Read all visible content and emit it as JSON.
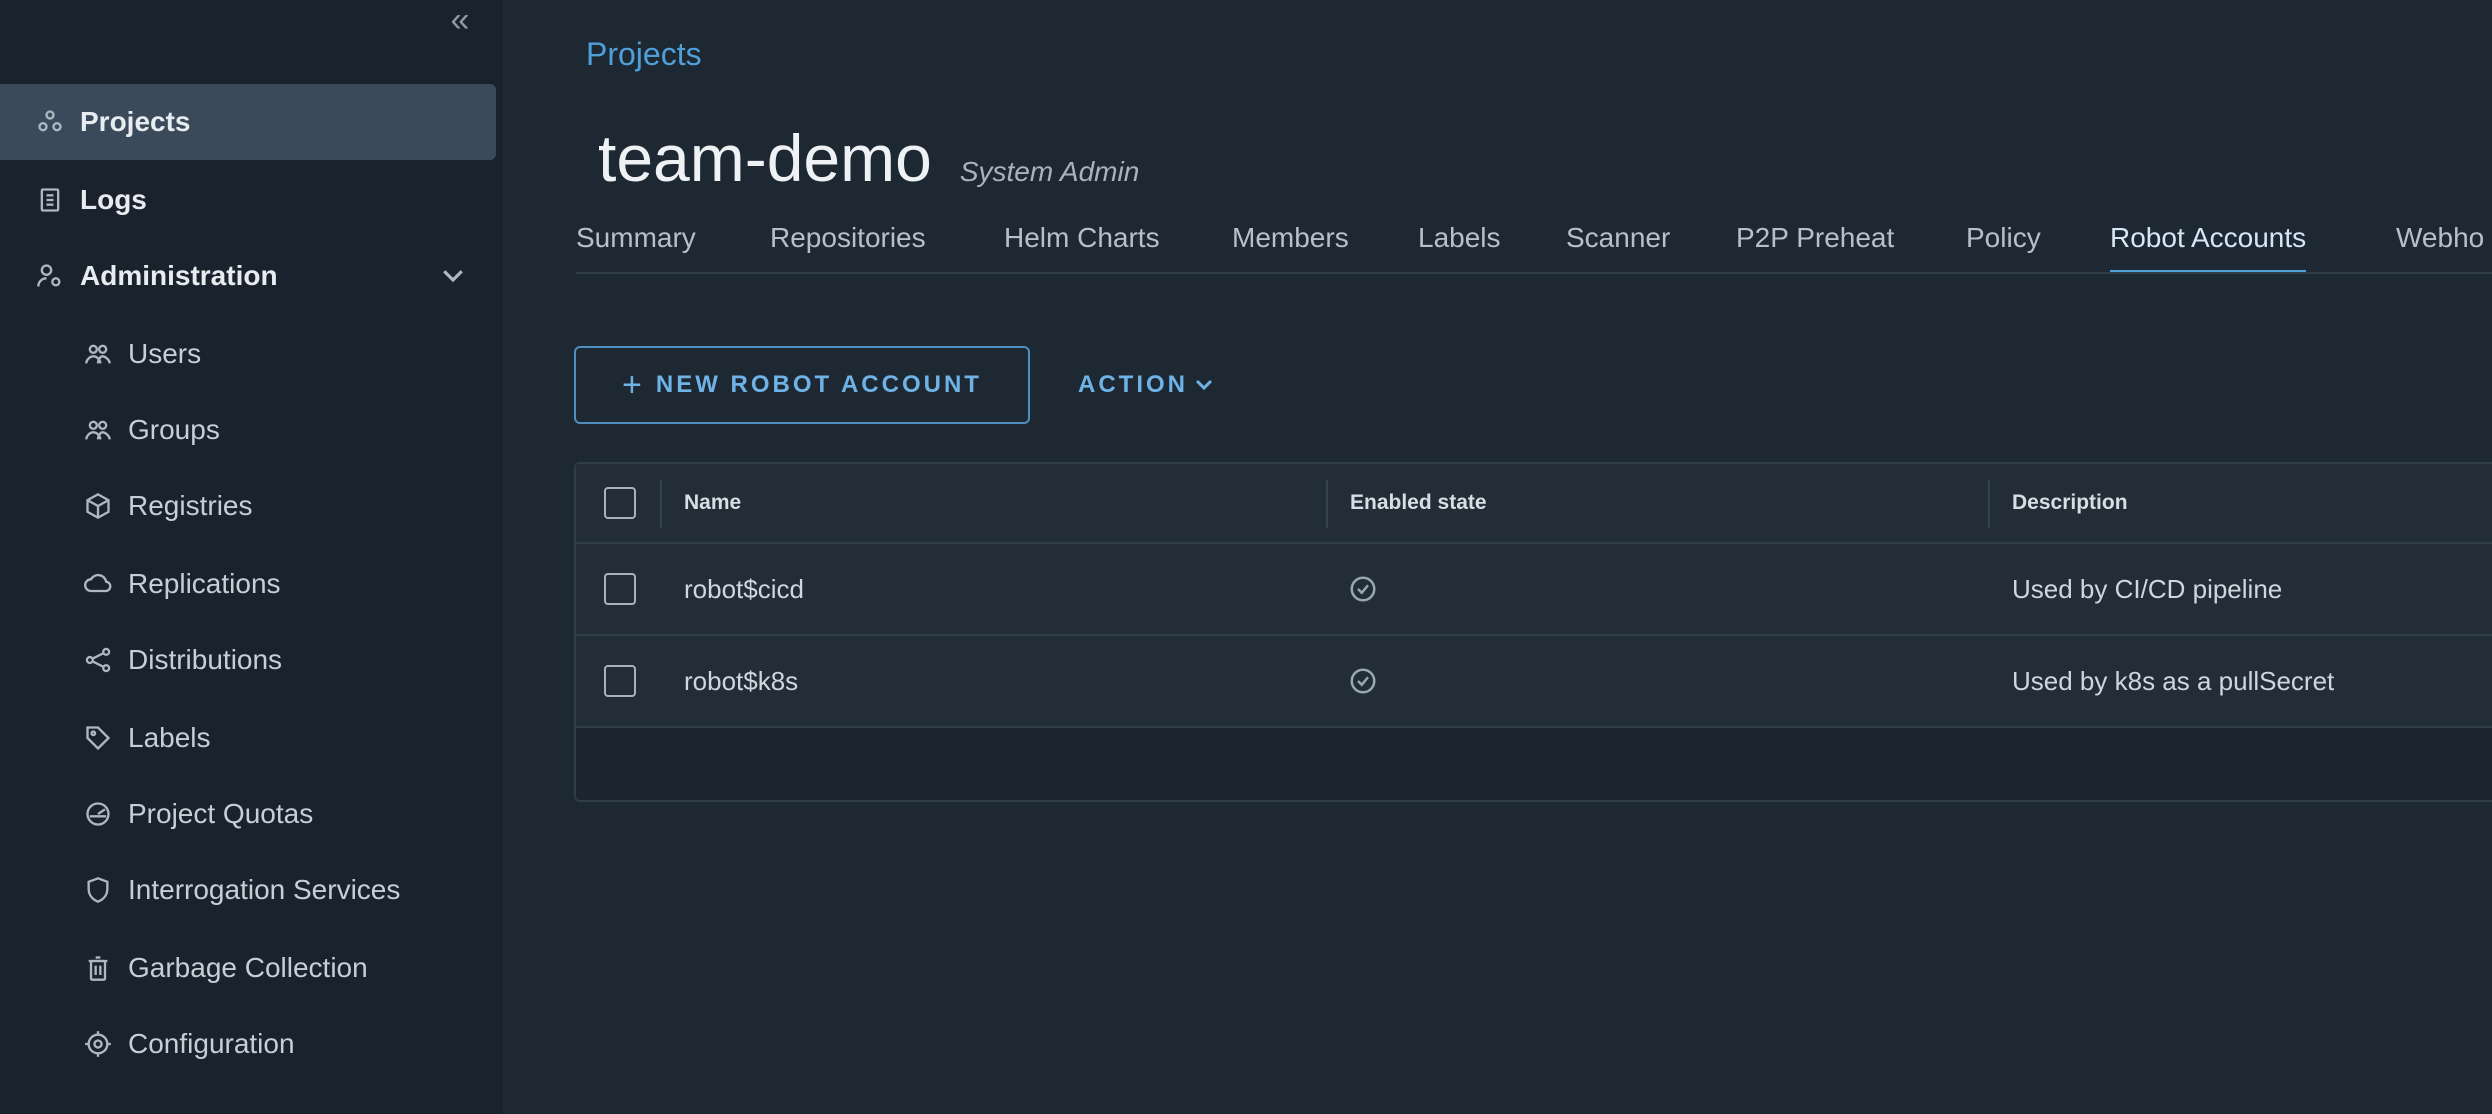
{
  "sidebar": {
    "collapse_glyph": "«",
    "items": [
      {
        "label": "Projects",
        "icon": "projects-icon"
      },
      {
        "label": "Logs",
        "icon": "logs-icon"
      },
      {
        "label": "Administration",
        "icon": "administration-icon"
      },
      {
        "label": "Users",
        "icon": "users-icon"
      },
      {
        "label": "Groups",
        "icon": "groups-icon"
      },
      {
        "label": "Registries",
        "icon": "registries-icon"
      },
      {
        "label": "Replications",
        "icon": "replications-icon"
      },
      {
        "label": "Distributions",
        "icon": "distributions-icon"
      },
      {
        "label": "Labels",
        "icon": "labels-icon"
      },
      {
        "label": "Project Quotas",
        "icon": "project-quotas-icon"
      },
      {
        "label": "Interrogation Services",
        "icon": "interrogation-services-icon"
      },
      {
        "label": "Garbage Collection",
        "icon": "garbage-collection-icon"
      },
      {
        "label": "Configuration",
        "icon": "configuration-icon"
      }
    ]
  },
  "header": {
    "breadcrumb": "Projects",
    "title": "team-demo",
    "role": "System Admin"
  },
  "tabs": [
    {
      "label": "Summary"
    },
    {
      "label": "Repositories"
    },
    {
      "label": "Helm Charts"
    },
    {
      "label": "Members"
    },
    {
      "label": "Labels"
    },
    {
      "label": "Scanner"
    },
    {
      "label": "P2P Preheat"
    },
    {
      "label": "Policy"
    },
    {
      "label": "Robot Accounts",
      "active": true
    },
    {
      "label": "Webho"
    }
  ],
  "toolbar": {
    "new_label": "NEW ROBOT ACCOUNT",
    "plus_glyph": "+",
    "action_label": "ACTION"
  },
  "table": {
    "columns": [
      "Name",
      "Enabled state",
      "Description"
    ],
    "rows": [
      {
        "name": "robot$cicd",
        "enabled": true,
        "description": "Used by CI/CD pipeline"
      },
      {
        "name": "robot$k8s",
        "enabled": true,
        "description": "Used by k8s as a pullSecret"
      }
    ]
  },
  "colors": {
    "accent": "#4f9fd8",
    "background": "#1e2833",
    "sidebar": "#1a232d",
    "active_nav": "#3a4a5b"
  }
}
